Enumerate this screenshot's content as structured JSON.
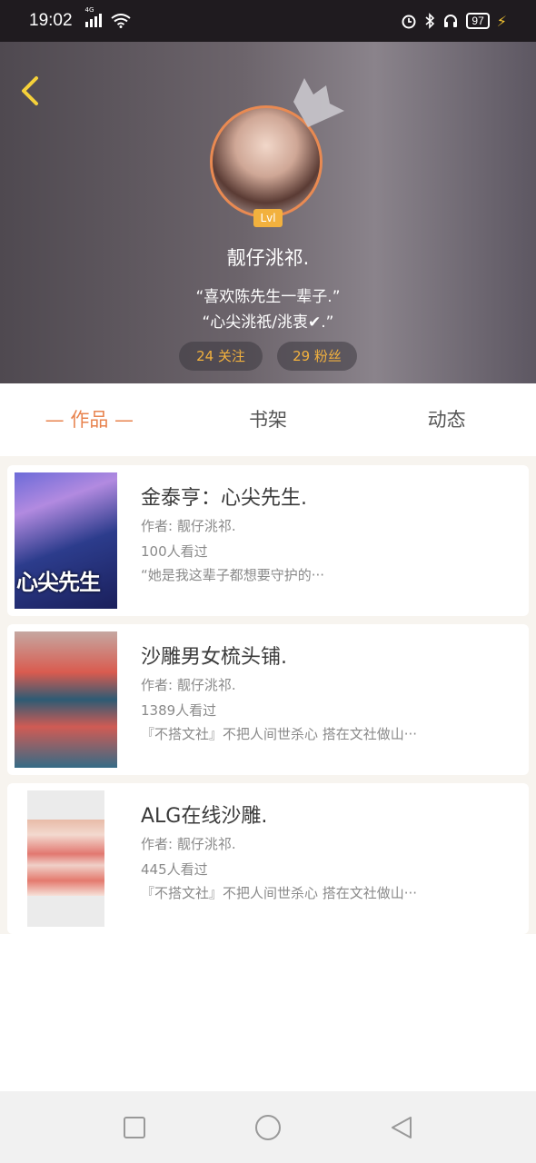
{
  "status_bar": {
    "time": "19:02",
    "network_label": "4G",
    "battery": "97"
  },
  "profile": {
    "level": "Lvl",
    "nickname": "靓仔洮祁.",
    "bio_line1": "“喜欢陈先生一辈子.”",
    "bio_line2": "“心尖洮祇/洮衷✔.”",
    "following": "24 关注",
    "followers": "29 粉丝"
  },
  "tabs": [
    {
      "label": "— 作品 —",
      "active": true
    },
    {
      "label": "书架",
      "active": false
    },
    {
      "label": "动态",
      "active": false
    }
  ],
  "works": [
    {
      "title": "金泰亨：心尖先生.",
      "author": "作者: 靓仔洮祁.",
      "views": "100人看过",
      "excerpt": "“她是我这辈子都想要守护的···",
      "cover_text": "心尖先生"
    },
    {
      "title": "沙雕男女梳头铺.",
      "author": "作者: 靓仔洮祁.",
      "views": "1389人看过",
      "excerpt": "『不搭文社』不把人间世杀心 搭在文社做山···"
    },
    {
      "title": "ALG在线沙雕.",
      "author": "作者: 靓仔洮祁.",
      "views": "445人看过",
      "excerpt": "『不搭文社』不把人间世杀心 搭在文社做山···"
    }
  ],
  "colors": {
    "accent": "#e8834e",
    "level_badge": "#f2b13e",
    "back_arrow": "#f5d13a"
  },
  "icons": {
    "back": "chevron-left-icon",
    "crown": "crown-icon",
    "nav_recent": "square-icon",
    "nav_home": "circle-icon",
    "nav_back": "triangle-left-icon"
  }
}
